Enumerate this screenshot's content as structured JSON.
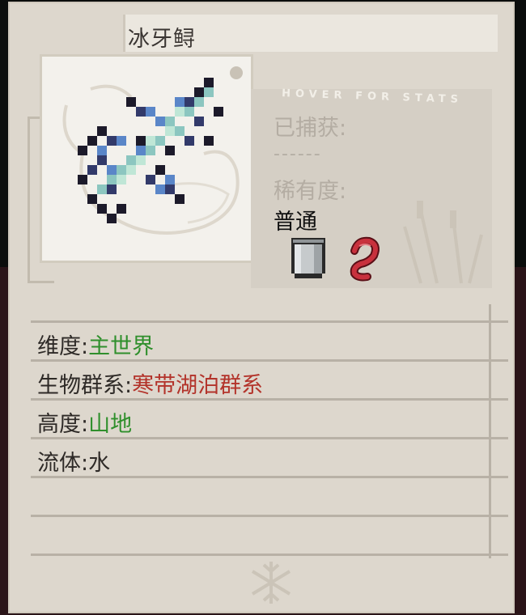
{
  "item": {
    "name": "冰牙鲟"
  },
  "stats_overlay": {
    "hover_hint": "HOVER FOR STATS",
    "caught_label": "已捕获:",
    "caught_value": "------",
    "rarity_label": "稀有度:",
    "rarity_value": "普通"
  },
  "details": {
    "dimension_label": "维度:",
    "dimension_value": "主世界",
    "biome_label": "生物群系:",
    "biome_value": "寒带湖泊群系",
    "height_label": "高度:",
    "height_value": "山地",
    "fluid_label": "流体:",
    "fluid_value": "水"
  },
  "icons": {
    "fish": "fish-sprite-icon",
    "bucket": "bucket-icon",
    "bait": "worm-bait-icon",
    "ornament": "snowflake-icon"
  },
  "colors": {
    "green_value": "#2f8f2c",
    "red_value": "#b3332a"
  }
}
